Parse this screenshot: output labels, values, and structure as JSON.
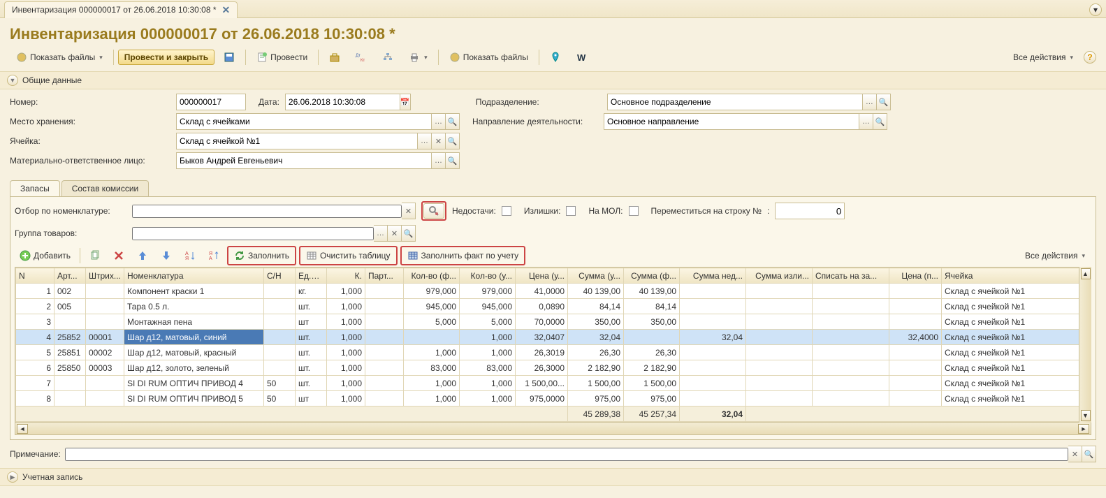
{
  "tab": {
    "title": "Инвентаризация 000000017 от 26.06.2018 10:30:08 *"
  },
  "page_title": "Инвентаризация 000000017 от 26.06.2018 10:30:08 *",
  "toolbar": {
    "show_files": "Показать файлы",
    "post_close": "Провести и закрыть",
    "post": "Провести",
    "show_files2": "Показать файлы",
    "all_actions": "Все действия"
  },
  "sections": {
    "common": "Общие данные",
    "accounting": "Учетная запись"
  },
  "form": {
    "number_label": "Номер:",
    "number": "000000017",
    "date_label": "Дата:",
    "date": "26.06.2018 10:30:08",
    "unit_label": "Подразделение:",
    "unit": "Основное подразделение",
    "storage_label": "Место хранения:",
    "storage": "Склад с ячейками",
    "direction_label": "Направление деятельности:",
    "direction": "Основное направление",
    "cell_label": "Ячейка:",
    "cell": "Склад с ячейкой №1",
    "mol_label": "Материально-ответственное лицо:",
    "mol": "Быков Андрей Евгеньевич"
  },
  "tabs": {
    "stock": "Запасы",
    "commission": "Состав комиссии"
  },
  "filters": {
    "by_nomen_label": "Отбор по номенклатуре:",
    "group_label": "Группа товаров:",
    "shortage_label": "Недостачи:",
    "surplus_label": "Излишки:",
    "on_mol_label": "На МОЛ:",
    "goto_row_label": "Переместиться на строку №",
    "goto_row_value": "0"
  },
  "grid_tb": {
    "add": "Добавить",
    "fill": "Заполнить",
    "clear": "Очистить таблицу",
    "fill_fact": "Заполнить факт по учету",
    "all_actions": "Все действия"
  },
  "cols": {
    "n": "N",
    "art": "Арт...",
    "bar": "Штрих...",
    "nom": "Номенклатура",
    "sn": "С/Н",
    "unit": "Ед.И...",
    "k": "К.",
    "batch": "Парт...",
    "qf": "Кол-во (ф...",
    "qu": "Кол-во (у...",
    "price": "Цена (у...",
    "sumu": "Сумма (у...",
    "sumf": "Сумма (ф...",
    "sumned": "Сумма нед...",
    "sumizl": "Сумма изли...",
    "spis": "Списать на за...",
    "pricep": "Цена (п...",
    "cell": "Ячейка"
  },
  "rows": [
    {
      "n": "1",
      "art": "002",
      "bar": "",
      "nom": "Компонент краски 1",
      "sn": "",
      "unit": "кг.",
      "k": "1,000",
      "batch": "",
      "qf": "979,000",
      "qu": "979,000",
      "price": "41,0000",
      "sumu": "40 139,00",
      "sumf": "40 139,00",
      "sumned": "",
      "sumizl": "",
      "spis": "",
      "pricep": "",
      "cell": "Склад с ячейкой №1"
    },
    {
      "n": "2",
      "art": "005",
      "bar": "",
      "nom": "Тара 0.5 л.",
      "sn": "",
      "unit": "шт.",
      "k": "1,000",
      "batch": "",
      "qf": "945,000",
      "qu": "945,000",
      "price": "0,0890",
      "sumu": "84,14",
      "sumf": "84,14",
      "sumned": "",
      "sumizl": "",
      "spis": "",
      "pricep": "",
      "cell": "Склад с ячейкой №1"
    },
    {
      "n": "3",
      "art": "",
      "bar": "",
      "nom": "Монтажная пена",
      "sn": "",
      "unit": "шт",
      "k": "1,000",
      "batch": "",
      "qf": "5,000",
      "qu": "5,000",
      "price": "70,0000",
      "sumu": "350,00",
      "sumf": "350,00",
      "sumned": "",
      "sumizl": "",
      "spis": "",
      "pricep": "",
      "cell": "Склад с ячейкой №1"
    },
    {
      "n": "4",
      "art": "25852",
      "bar": "00001",
      "nom": "Шар д12, матовый, синий",
      "sn": "",
      "unit": "шт.",
      "k": "1,000",
      "batch": "",
      "qf": "",
      "qu": "1,000",
      "price": "32,0407",
      "sumu": "32,04",
      "sumf": "",
      "sumned": "32,04",
      "sumizl": "",
      "spis": "",
      "pricep": "32,4000",
      "cell": "Склад с ячейкой №1",
      "sel": true
    },
    {
      "n": "5",
      "art": "25851",
      "bar": "00002",
      "nom": "Шар д12, матовый, красный",
      "sn": "",
      "unit": "шт.",
      "k": "1,000",
      "batch": "",
      "qf": "1,000",
      "qu": "1,000",
      "price": "26,3019",
      "sumu": "26,30",
      "sumf": "26,30",
      "sumned": "",
      "sumizl": "",
      "spis": "",
      "pricep": "",
      "cell": "Склад с ячейкой №1"
    },
    {
      "n": "6",
      "art": "25850",
      "bar": "00003",
      "nom": "Шар д12, золото, зеленый",
      "sn": "",
      "unit": "шт.",
      "k": "1,000",
      "batch": "",
      "qf": "83,000",
      "qu": "83,000",
      "price": "26,3000",
      "sumu": "2 182,90",
      "sumf": "2 182,90",
      "sumned": "",
      "sumizl": "",
      "spis": "",
      "pricep": "",
      "cell": "Склад с ячейкой №1"
    },
    {
      "n": "7",
      "art": "",
      "bar": "",
      "nom": "SI DI RUM ОПТИЧ ПРИВОД 4",
      "sn": "50",
      "unit": "шт.",
      "k": "1,000",
      "batch": "",
      "qf": "1,000",
      "qu": "1,000",
      "price": "1 500,00...",
      "sumu": "1 500,00",
      "sumf": "1 500,00",
      "sumned": "",
      "sumizl": "",
      "spis": "",
      "pricep": "",
      "cell": "Склад с ячейкой №1"
    },
    {
      "n": "8",
      "art": "",
      "bar": "",
      "nom": "SI DI RUM ОПТИЧ ПРИВОД 5",
      "sn": "50",
      "unit": "шт",
      "k": "1,000",
      "batch": "",
      "qf": "1,000",
      "qu": "1,000",
      "price": "975,0000",
      "sumu": "975,00",
      "sumf": "975,00",
      "sumned": "",
      "sumizl": "",
      "spis": "",
      "pricep": "",
      "cell": "Склад с ячейкой №1"
    }
  ],
  "totals": {
    "sumu": "45 289,38",
    "sumf": "45 257,34",
    "sumned": "32,04"
  },
  "footer": {
    "note_label": "Примечание:"
  }
}
